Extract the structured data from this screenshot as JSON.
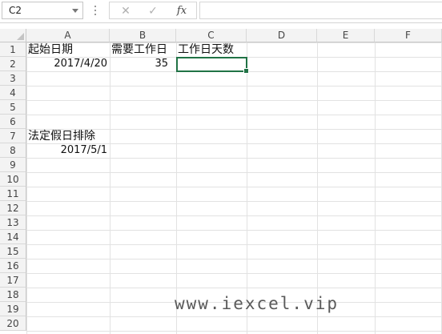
{
  "formula_bar": {
    "name_box": "C2",
    "cancel_icon": "✕",
    "enter_icon": "✓",
    "function_label": "fx",
    "formula": ""
  },
  "columns": [
    "A",
    "B",
    "C",
    "D",
    "E",
    "F"
  ],
  "rows": [
    "1",
    "2",
    "3",
    "4",
    "5",
    "6",
    "7",
    "8",
    "9",
    "10",
    "11",
    "12",
    "13",
    "14",
    "15",
    "16",
    "17",
    "18",
    "19",
    "20"
  ],
  "cells": {
    "A1": "起始日期",
    "B1": "需要工作日",
    "C1": "工作日天数",
    "A2": "2017/4/20",
    "B2": "35",
    "A7": "法定假日排除",
    "A8": "2017/5/1"
  },
  "selected_cell": "C2",
  "watermark": "www.iexcel.vip",
  "colors": {
    "selection": "#217346",
    "header_bg": "#f3f3f3",
    "gridline": "#e2e2e2"
  }
}
